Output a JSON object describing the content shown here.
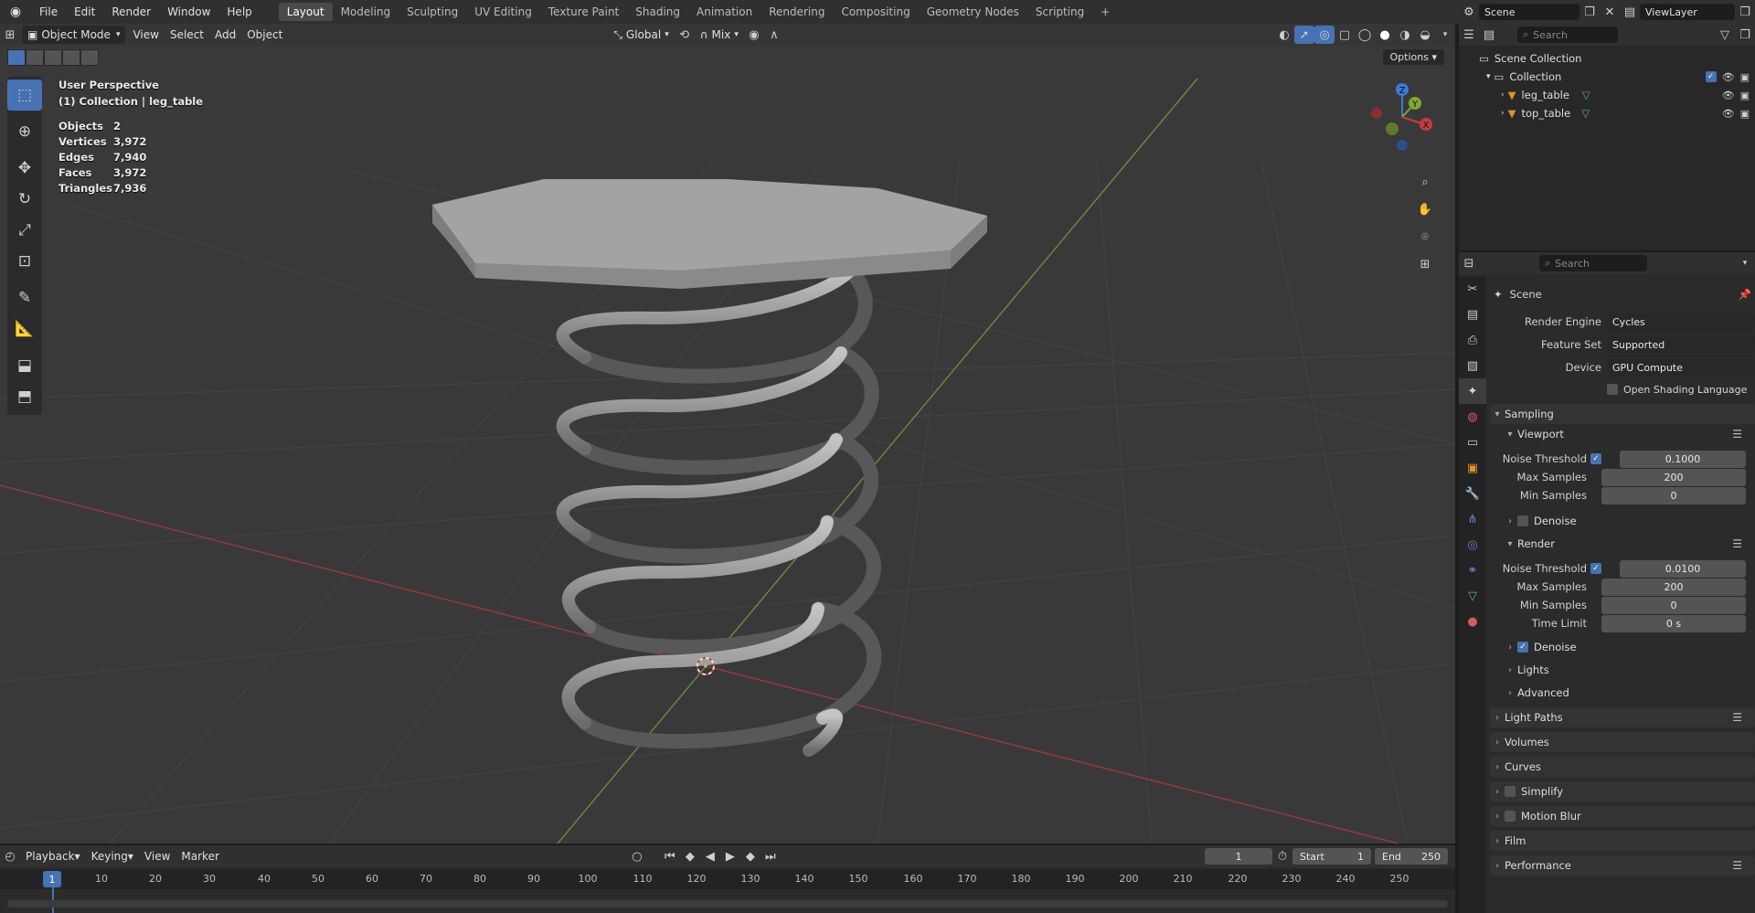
{
  "topbar": {
    "menus": [
      "File",
      "Edit",
      "Render",
      "Window",
      "Help"
    ],
    "workspaces": [
      "Layout",
      "Modeling",
      "Sculpting",
      "UV Editing",
      "Texture Paint",
      "Shading",
      "Animation",
      "Rendering",
      "Compositing",
      "Geometry Nodes",
      "Scripting"
    ],
    "active_workspace": "Layout",
    "add_workspace": "+",
    "scene_name": "Scene",
    "view_layer_name": "ViewLayer"
  },
  "viewport_header": {
    "mode": "Object Mode",
    "menus": [
      "View",
      "Select",
      "Add",
      "Object"
    ],
    "orientation": "Global",
    "snap_mode": "Mix",
    "options_label": "Options"
  },
  "overlay": {
    "perspective": "User Perspective",
    "collection_line": "(1) Collection | leg_table",
    "stats": [
      {
        "label": "Objects",
        "value": "2"
      },
      {
        "label": "Vertices",
        "value": "3,972"
      },
      {
        "label": "Edges",
        "value": "7,940"
      },
      {
        "label": "Faces",
        "value": "3,972"
      },
      {
        "label": "Triangles",
        "value": "7,936"
      }
    ]
  },
  "gizmo": {
    "z": "Z",
    "y": "Y",
    "x": "X"
  },
  "timeline": {
    "menus": [
      "Playback",
      "Keying",
      "View",
      "Marker"
    ],
    "current_frame": "1",
    "start_label": "Start",
    "start_value": "1",
    "end_label": "End",
    "end_value": "250",
    "ruler_ticks": [
      "1",
      "10",
      "20",
      "30",
      "40",
      "50",
      "60",
      "70",
      "80",
      "90",
      "100",
      "110",
      "120",
      "130",
      "140",
      "150",
      "160",
      "170",
      "180",
      "190",
      "200",
      "210",
      "220",
      "230",
      "240",
      "250"
    ]
  },
  "outliner": {
    "search_placeholder": "Search",
    "scene_collection": "Scene Collection",
    "collection": "Collection",
    "objects": [
      "leg_table",
      "top_table"
    ]
  },
  "properties": {
    "search_placeholder": "Search",
    "context": "Scene",
    "render_engine_label": "Render Engine",
    "render_engine": "Cycles",
    "feature_set_label": "Feature Set",
    "feature_set": "Supported",
    "device_label": "Device",
    "device": "GPU Compute",
    "osl_label": "Open Shading Language",
    "sampling": "Sampling",
    "viewport": "Viewport",
    "noise_threshold_label": "Noise Threshold",
    "viewport_noise_threshold": "0.1000",
    "max_samples_label": "Max Samples",
    "viewport_max_samples": "200",
    "min_samples_label": "Min Samples",
    "viewport_min_samples": "0",
    "denoise_label": "Denoise",
    "render": "Render",
    "render_noise_threshold": "0.0100",
    "render_max_samples": "200",
    "render_min_samples": "0",
    "time_limit_label": "Time Limit",
    "time_limit": "0 s",
    "lights": "Lights",
    "advanced": "Advanced",
    "panels": [
      "Light Paths",
      "Volumes",
      "Curves",
      "Simplify",
      "Motion Blur",
      "Film",
      "Performance"
    ]
  },
  "colors": {
    "accent": "#4772b3",
    "x_axis": "#c83c3c",
    "y_axis": "#7fa836",
    "z_axis": "#3d7ad6",
    "mesh": "#9a9a9a"
  }
}
